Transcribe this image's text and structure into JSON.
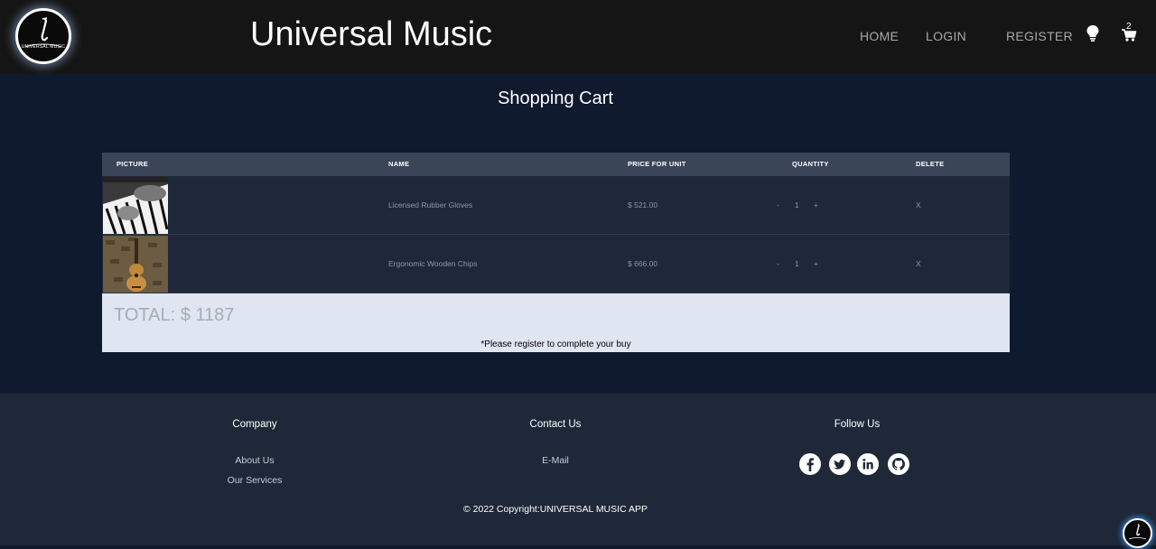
{
  "header": {
    "logo_text": "UNIVERSAL MUSIC",
    "brand": "Universal Music",
    "nav": {
      "home": "HOME",
      "login": "LOGIN",
      "register": "REGISTER"
    },
    "cart_count": "2",
    "icons": [
      "lightbulb-icon",
      "cart-icon"
    ]
  },
  "page": {
    "title": "Shopping Cart"
  },
  "table": {
    "headers": [
      "PICTURE",
      "NAME",
      "PRICE FOR UNIT",
      "QUANTITY",
      "DELETE"
    ],
    "rows": [
      {
        "image": "piano-hands-photo",
        "name": "Licensed Rubber Gloves",
        "price": "$ 521.00",
        "minus": "-",
        "qty": "1",
        "plus": "+",
        "delete": "X"
      },
      {
        "image": "acoustic-guitar-photo",
        "name": "Ergonomic Wooden Chips",
        "price": "$ 666.00",
        "minus": "-",
        "qty": "1",
        "plus": "+",
        "delete": "X"
      }
    ],
    "total": "TOTAL: $ 1187",
    "note": "*Please register to complete your buy"
  },
  "footer": {
    "company": {
      "heading": "Company",
      "links": [
        "About Us",
        "Our Services"
      ]
    },
    "contact": {
      "heading": "Contact Us",
      "links": [
        "E-Mail"
      ]
    },
    "follow": {
      "heading": "Follow Us",
      "icons": [
        "facebook-icon",
        "twitter-icon",
        "linkedin-icon",
        "github-icon"
      ]
    },
    "copyright": "© 2022 Copyright:UNIVERSAL MUSIC APP"
  }
}
